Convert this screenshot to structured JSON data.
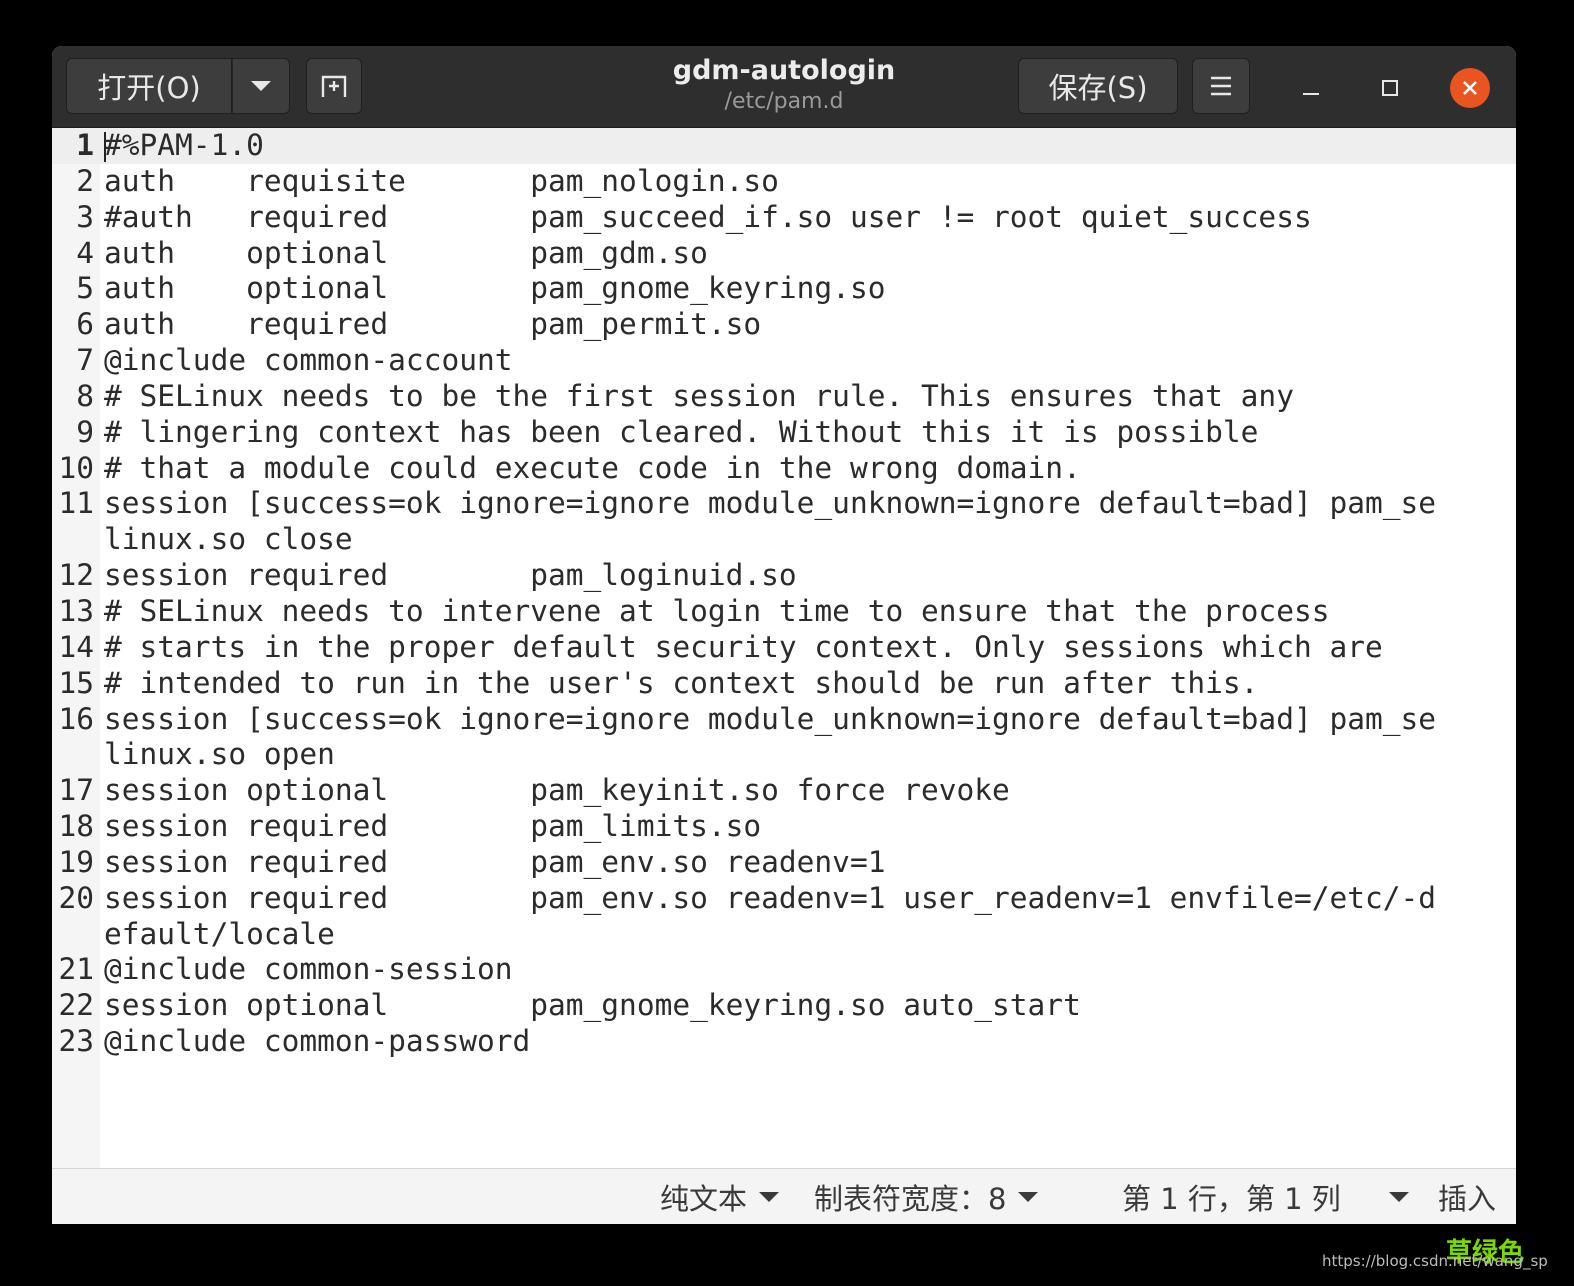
{
  "header": {
    "open_label": "打开(O)",
    "save_label": "保存(S)",
    "title": "gdm-autologin",
    "subtitle": "/etc/pam.d"
  },
  "editor": {
    "current_line": 1,
    "lines": [
      {
        "n": "1",
        "text": "#%PAM-1.0"
      },
      {
        "n": "2",
        "text": "auth    requisite       pam_nologin.so"
      },
      {
        "n": "3",
        "text": "#auth   required        pam_succeed_if.so user != root quiet_success"
      },
      {
        "n": "4",
        "text": "auth    optional        pam_gdm.so"
      },
      {
        "n": "5",
        "text": "auth    optional        pam_gnome_keyring.so"
      },
      {
        "n": "6",
        "text": "auth    required        pam_permit.so"
      },
      {
        "n": "7",
        "text": "@include common-account"
      },
      {
        "n": "8",
        "text": "# SELinux needs to be the first session rule. This ensures that any"
      },
      {
        "n": "9",
        "text": "# lingering context has been cleared. Without this it is possible"
      },
      {
        "n": "10",
        "text": "# that a module could execute code in the wrong domain."
      },
      {
        "n": "11",
        "text": "session [success=ok ignore=ignore module_unknown=ignore default=bad] pam_selinux.so close"
      },
      {
        "n": "12",
        "text": "session required        pam_loginuid.so"
      },
      {
        "n": "13",
        "text": "# SELinux needs to intervene at login time to ensure that the process"
      },
      {
        "n": "14",
        "text": "# starts in the proper default security context. Only sessions which are"
      },
      {
        "n": "15",
        "text": "# intended to run in the user's context should be run after this."
      },
      {
        "n": "16",
        "text": "session [success=ok ignore=ignore module_unknown=ignore default=bad] pam_selinux.so open"
      },
      {
        "n": "17",
        "text": "session optional        pam_keyinit.so force revoke"
      },
      {
        "n": "18",
        "text": "session required        pam_limits.so"
      },
      {
        "n": "19",
        "text": "session required        pam_env.so readenv=1"
      },
      {
        "n": "20",
        "text": "session required        pam_env.so readenv=1 user_readenv=1 envfile=/etc/-default/locale"
      },
      {
        "n": "21",
        "text": "@include common-session"
      },
      {
        "n": "22",
        "text": "session optional        pam_gnome_keyring.so auto_start"
      },
      {
        "n": "23",
        "text": "@include common-password"
      }
    ]
  },
  "statusbar": {
    "syntax": "纯文本",
    "tab_width": "制表符宽度：8",
    "position": "第 1 行，第 1 列",
    "mode": "插入"
  },
  "watermark": {
    "name": "草绿色",
    "url": "https://blog.csdn.net/wang_sp"
  },
  "colors": {
    "headerbar": "#2e2e2e",
    "close_button": "#e95420",
    "editor_bg": "#ffffff",
    "gutter_bg": "#f5f5f5",
    "current_line_bg": "#eeeeee"
  }
}
